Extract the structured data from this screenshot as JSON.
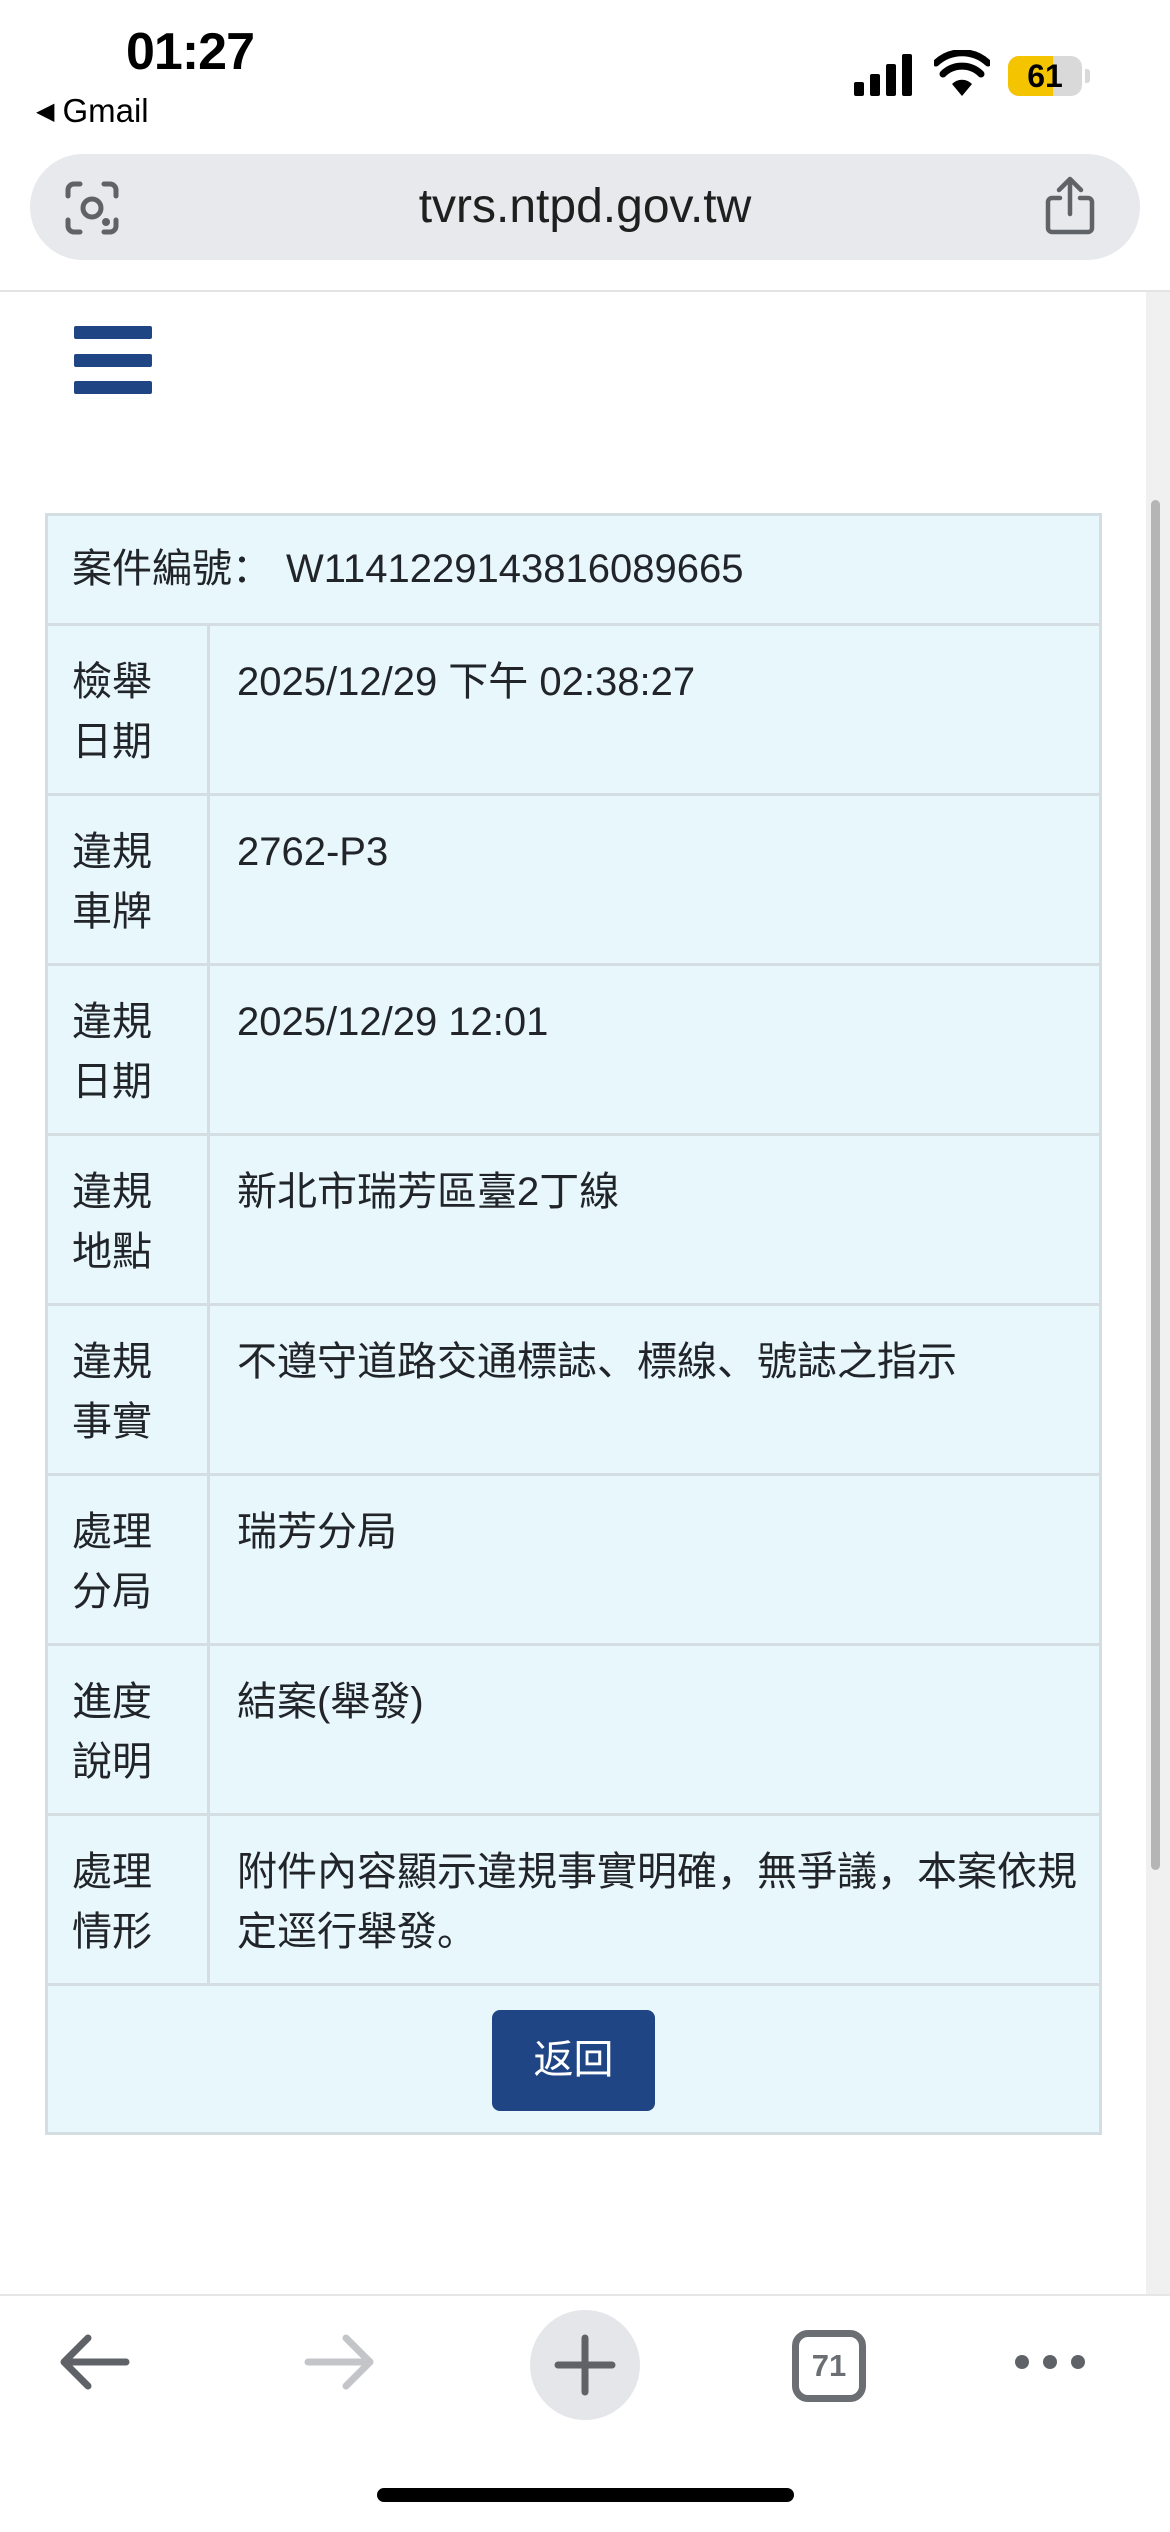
{
  "status_bar": {
    "time": "01:27",
    "back_app": "Gmail",
    "battery_level": 61,
    "battery_text": "61"
  },
  "browser": {
    "url": "tvrs.ntpd.gov.tw",
    "open_tabs_count": "71"
  },
  "case": {
    "id_label": "案件編號：",
    "id_value": "W1141229143816089665"
  },
  "rows": [
    {
      "label_1": "檢舉",
      "label_2": "日期",
      "value": "2025/12/29 下午 02:38:27"
    },
    {
      "label_1": "違規",
      "label_2": "車牌",
      "value": "2762-P3"
    },
    {
      "label_1": "違規",
      "label_2": "日期",
      "value": "2025/12/29 12:01"
    },
    {
      "label_1": "違規",
      "label_2": "地點",
      "value": "新北市瑞芳區臺2丁線"
    },
    {
      "label_1": "違規",
      "label_2": "事實",
      "value": "不遵守道路交通標誌、標線、號誌之指示"
    },
    {
      "label_1": "處理",
      "label_2": "分局",
      "value": "瑞芳分局"
    },
    {
      "label_1": "進度",
      "label_2": "說明",
      "value": "結案(舉發)"
    },
    {
      "label_1": "處理",
      "label_2": "情形",
      "value": "附件內容顯示違規事實明確，無爭議，本案依規定逕行舉發。"
    }
  ],
  "actions": {
    "back_label": "返回"
  },
  "colors": {
    "primary": "#1f4584",
    "card_bg": "#e8f7fb",
    "border": "#d3dde2",
    "battery": "#f5c400"
  }
}
